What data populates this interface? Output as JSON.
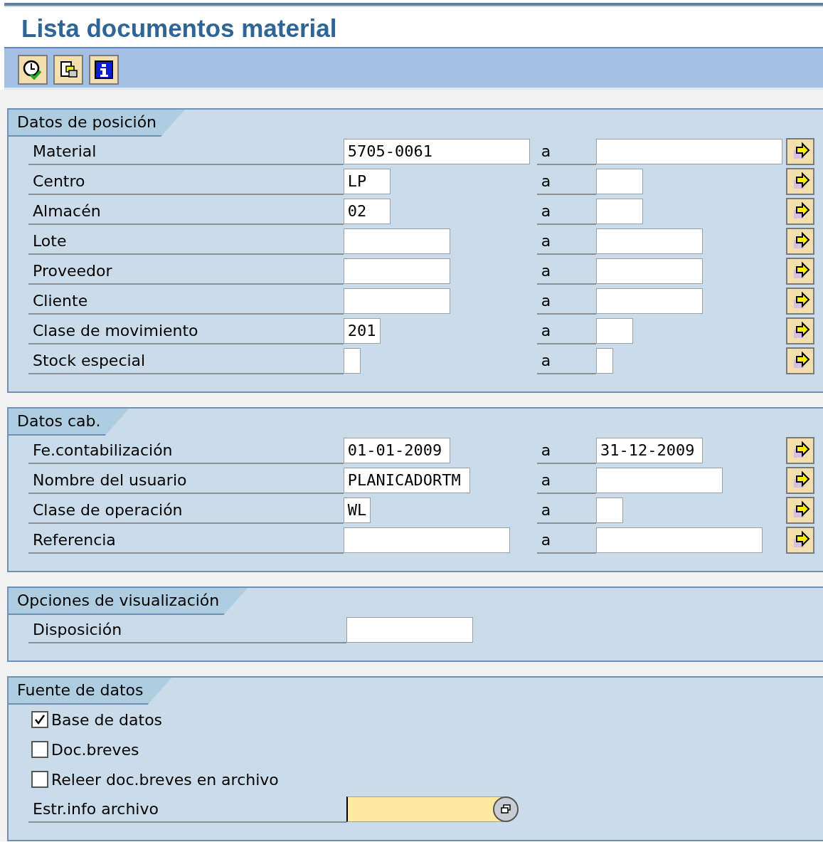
{
  "window": {
    "title": "Lista documentos material"
  },
  "toolbar": [
    {
      "kind": "execute"
    },
    {
      "kind": "variants"
    },
    {
      "kind": "info"
    }
  ],
  "sections": [
    {
      "title": "Datos de posición",
      "rows": [
        {
          "kind": "range",
          "label": "Material",
          "from": "5705-0061",
          "separator": "a",
          "to": ""
        },
        {
          "kind": "range",
          "label": "Centro",
          "from": "LP",
          "separator": "a",
          "to": ""
        },
        {
          "kind": "range",
          "label": "Almacén",
          "from": "02",
          "separator": "a",
          "to": ""
        },
        {
          "kind": "range",
          "label": "Lote",
          "from": "",
          "separator": "a",
          "to": ""
        },
        {
          "kind": "range",
          "label": "Proveedor",
          "from": "",
          "separator": "a",
          "to": ""
        },
        {
          "kind": "range",
          "label": "Cliente",
          "from": "",
          "separator": "a",
          "to": ""
        },
        {
          "kind": "range",
          "label": "Clase de movimiento",
          "from": "201",
          "separator": "a",
          "to": ""
        },
        {
          "kind": "range",
          "label": "Stock especial",
          "from": "",
          "separator": "a",
          "to": ""
        }
      ]
    },
    {
      "title": "Datos cab.",
      "rows": [
        {
          "kind": "range",
          "label": "Fe.contabilización",
          "from": "01-01-2009",
          "separator": "a",
          "to": "31-12-2009"
        },
        {
          "kind": "range",
          "label": "Nombre del usuario",
          "from": "PLANICADORTM",
          "separator": "a",
          "to": ""
        },
        {
          "kind": "range",
          "label": "Clase de operación",
          "from": "WL",
          "separator": "a",
          "to": ""
        },
        {
          "kind": "range",
          "label": "Referencia",
          "from": "",
          "separator": "a",
          "to": ""
        }
      ]
    },
    {
      "title": "Opciones de visualización",
      "rows": [
        {
          "kind": "single",
          "label": "Disposición",
          "value": ""
        }
      ]
    },
    {
      "title": "Fuente de datos",
      "rows": [
        {
          "kind": "checkbox",
          "label": "Base de datos",
          "checked": true
        },
        {
          "kind": "checkbox",
          "label": "Doc.breves",
          "checked": false
        },
        {
          "kind": "checkbox",
          "label": "Releer doc.breves en archivo",
          "checked": false
        },
        {
          "kind": "search",
          "label": "Estr.info archivo",
          "value": "",
          "focused": true
        }
      ]
    }
  ]
}
